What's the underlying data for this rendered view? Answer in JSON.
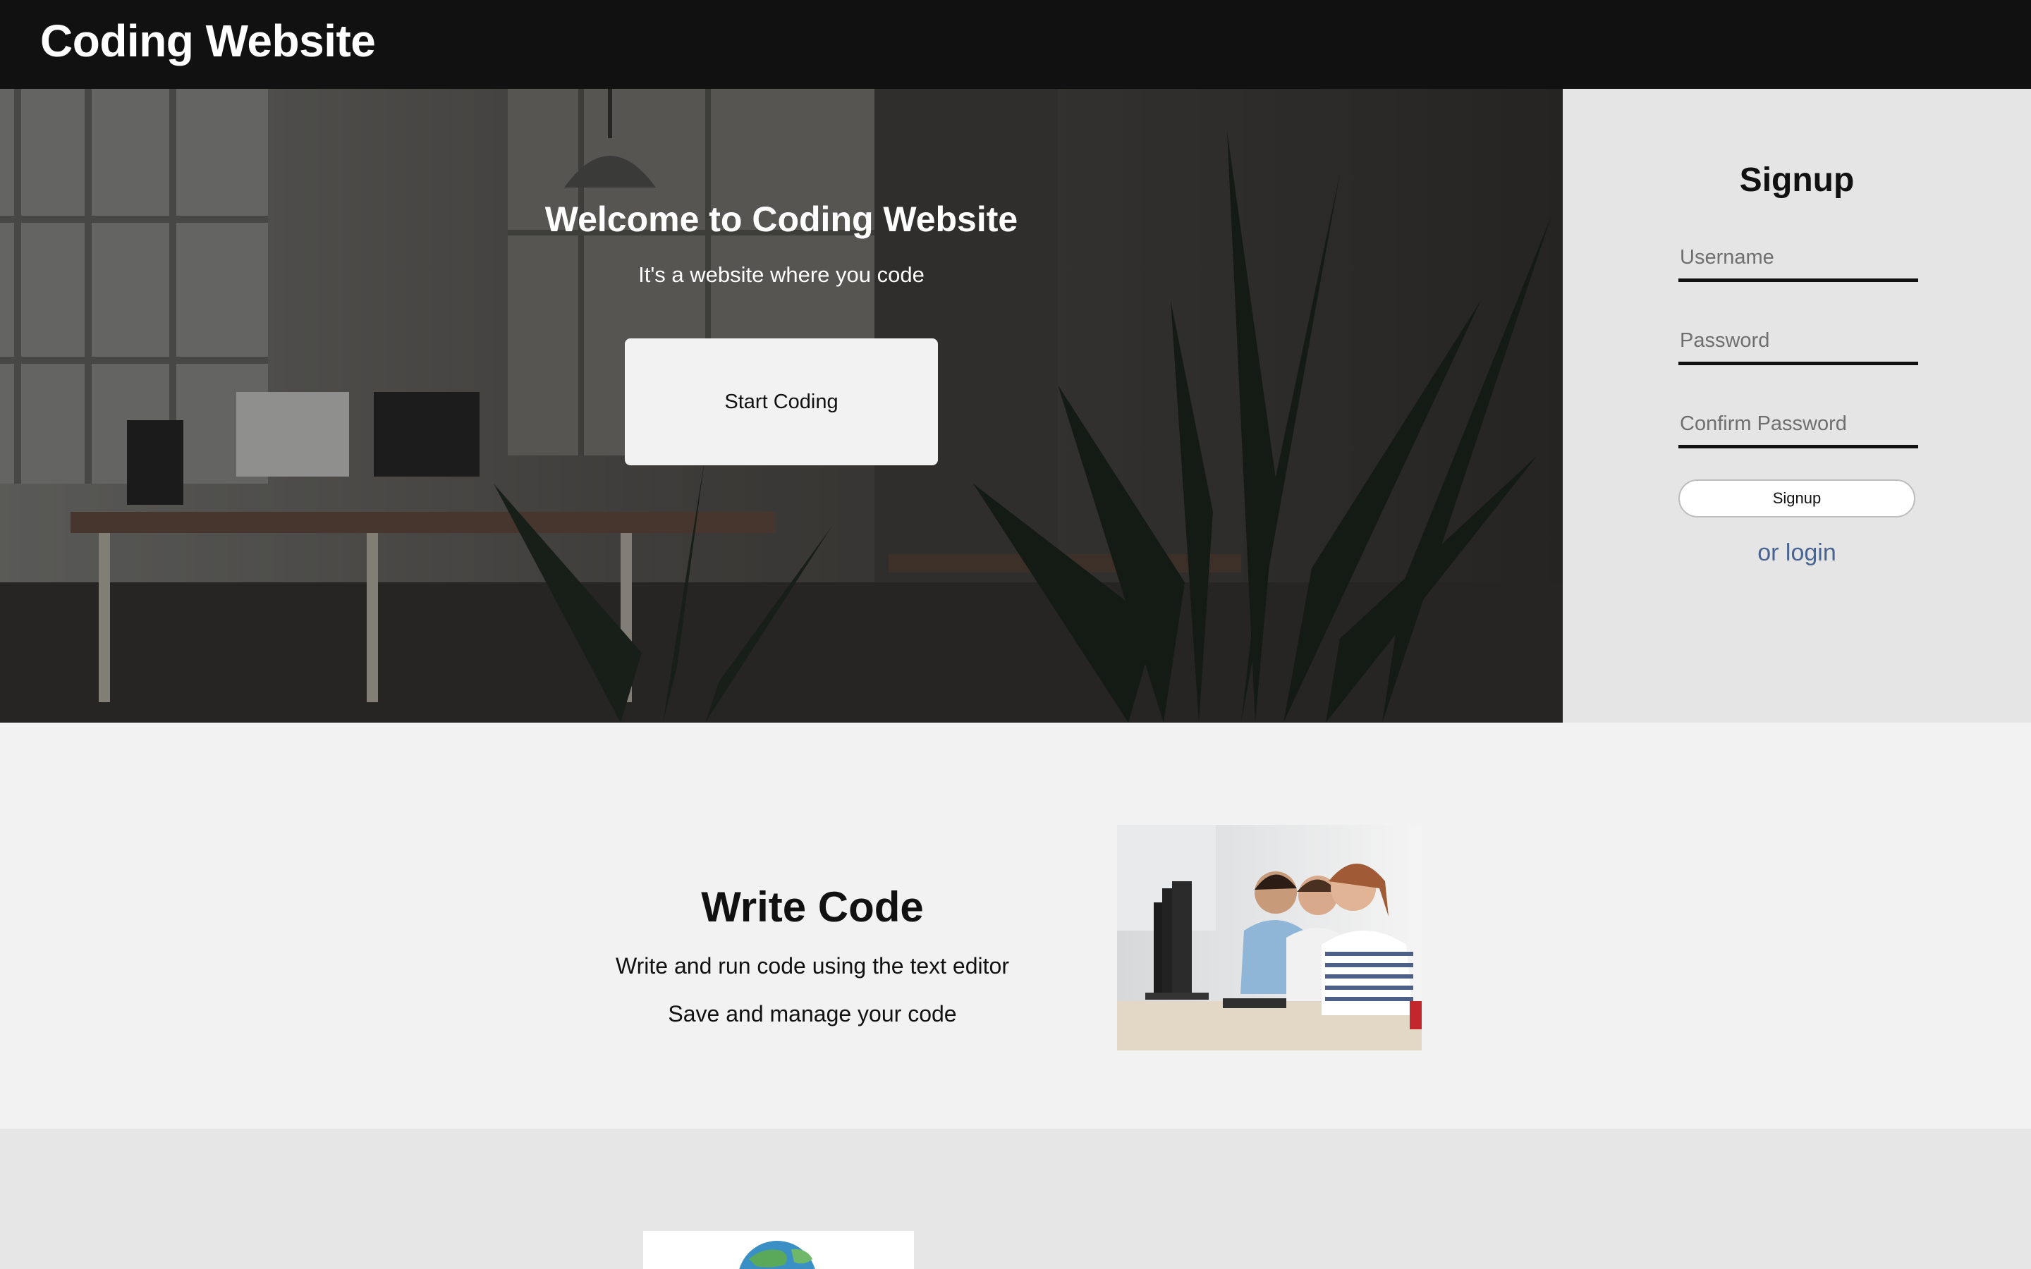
{
  "header": {
    "title": "Coding Website"
  },
  "hero": {
    "title": "Welcome to Coding Website",
    "subtitle": "It's a website where you code",
    "button_label": "Start Coding"
  },
  "signup": {
    "title": "Signup",
    "username_placeholder": "Username",
    "password_placeholder": "Password",
    "confirm_placeholder": "Confirm Password",
    "button_label": "Signup",
    "login_link": "or login"
  },
  "feature": {
    "title": "Write Code",
    "lines": [
      "Write and run code using the text editor",
      "Save and manage your code"
    ]
  },
  "colors": {
    "header_bg": "#111111",
    "signup_bg": "#e5e5e5",
    "page_bg": "#f2f2f2",
    "section2_bg": "#e6e6e6",
    "link": "#4a6491"
  }
}
